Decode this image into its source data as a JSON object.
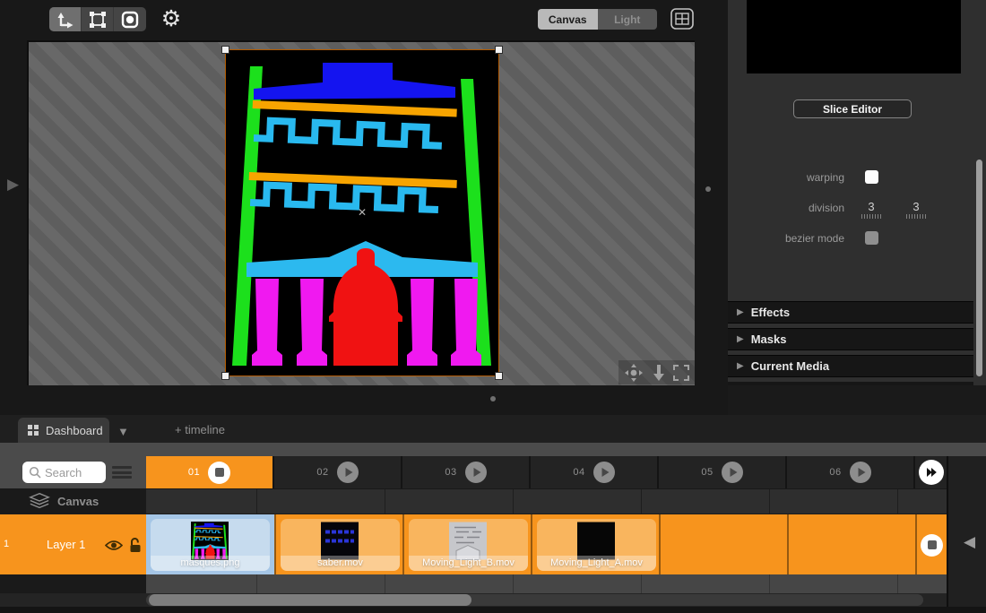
{
  "colors": {
    "accent_orange": "#F7941D",
    "card_orange": "#F9B55E",
    "selected_cell_blue": "#A5C6E6",
    "card_blue": "#C6DBEE",
    "panel_gray": "#2F2F2F",
    "workspace_gray": "#181818"
  },
  "glyphs": {
    "gear": "⚙",
    "caret_right": "▶",
    "caret_down": "▼",
    "caret_left": "◀",
    "cross": "✕"
  },
  "toolbar": {
    "view_toggle": {
      "canvas_label": "Canvas",
      "light_label": "Light",
      "selected": "Canvas"
    }
  },
  "right_panel": {
    "slice_editor_button": "Slice Editor",
    "warping_label": "warping",
    "warping_enabled": true,
    "division_label": "division",
    "division_x": "3",
    "division_y": "3",
    "bezier_mode_label": "bezier mode",
    "bezier_mode_enabled": false,
    "sections": [
      {
        "label": "Effects"
      },
      {
        "label": "Masks"
      },
      {
        "label": "Current Media"
      }
    ]
  },
  "bottom_tabs": {
    "dashboard_label": "Dashboard",
    "new_timeline_label": "+ timeline"
  },
  "timeline": {
    "search_placeholder": "Search",
    "columns": [
      {
        "label": "01",
        "active": true,
        "transport": "stop"
      },
      {
        "label": "02",
        "active": false,
        "transport": "play"
      },
      {
        "label": "03",
        "active": false,
        "transport": "play"
      },
      {
        "label": "04",
        "active": false,
        "transport": "play"
      },
      {
        "label": "05",
        "active": false,
        "transport": "play"
      },
      {
        "label": "06",
        "active": false,
        "transport": "play"
      }
    ],
    "canvas_row_label": "Canvas",
    "layer_row": {
      "index": "1",
      "name": "Layer 1",
      "visible": true,
      "locked": false,
      "transport": "stop"
    },
    "media_cells": [
      {
        "column": "01",
        "filename": "masques.png",
        "selected": true
      },
      {
        "column": "02",
        "filename": "saber.mov",
        "selected": false
      },
      {
        "column": "03",
        "filename": "Moving_Light_B.mov",
        "selected": false
      },
      {
        "column": "04",
        "filename": "Moving_Light_A.mov",
        "selected": false
      }
    ]
  }
}
